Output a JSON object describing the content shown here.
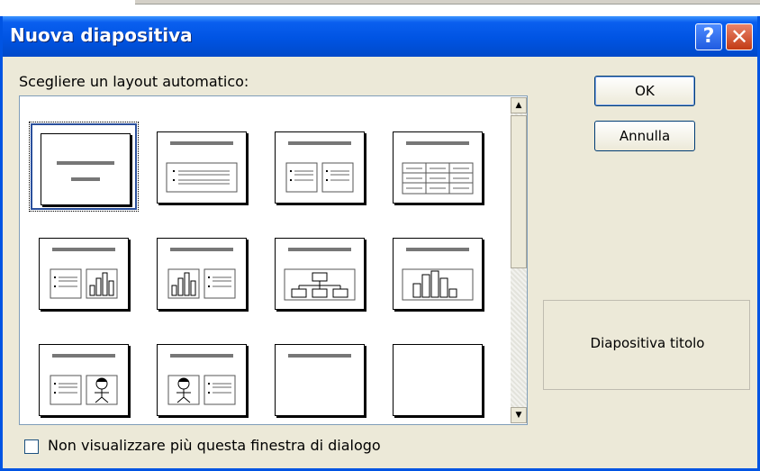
{
  "dialog": {
    "title": "Nuova diapositiva",
    "help_icon": "help-question-icon",
    "close_icon": "close-x-icon",
    "prompt": "Scegliere un layout automatico:",
    "ok_label": "OK",
    "cancel_label": "Annulla",
    "preview_label": "Diapositiva titolo",
    "checkbox_label": "Non visualizzare più questa finestra di dialogo",
    "checkbox_checked": false,
    "layouts": [
      {
        "id": "title-slide",
        "icon": "title-slide-layout-icon",
        "selected": true
      },
      {
        "id": "bulleted-list",
        "icon": "bulleted-list-layout-icon"
      },
      {
        "id": "two-column-text",
        "icon": "two-column-text-layout-icon"
      },
      {
        "id": "table",
        "icon": "table-layout-icon"
      },
      {
        "id": "text-and-chart",
        "icon": "text-chart-layout-icon"
      },
      {
        "id": "chart-and-text",
        "icon": "chart-text-layout-icon"
      },
      {
        "id": "org-chart",
        "icon": "org-chart-layout-icon"
      },
      {
        "id": "chart",
        "icon": "chart-layout-icon"
      },
      {
        "id": "text-and-clip-art",
        "icon": "text-clipart-layout-icon"
      },
      {
        "id": "clip-art-and-text",
        "icon": "clipart-text-layout-icon"
      },
      {
        "id": "title-only",
        "icon": "title-only-layout-icon"
      },
      {
        "id": "blank",
        "icon": "blank-layout-icon"
      }
    ],
    "colors": {
      "titlebar": "#0054e3",
      "dialog_bg": "#ece9d8",
      "selection": "#2a4f9c"
    }
  }
}
